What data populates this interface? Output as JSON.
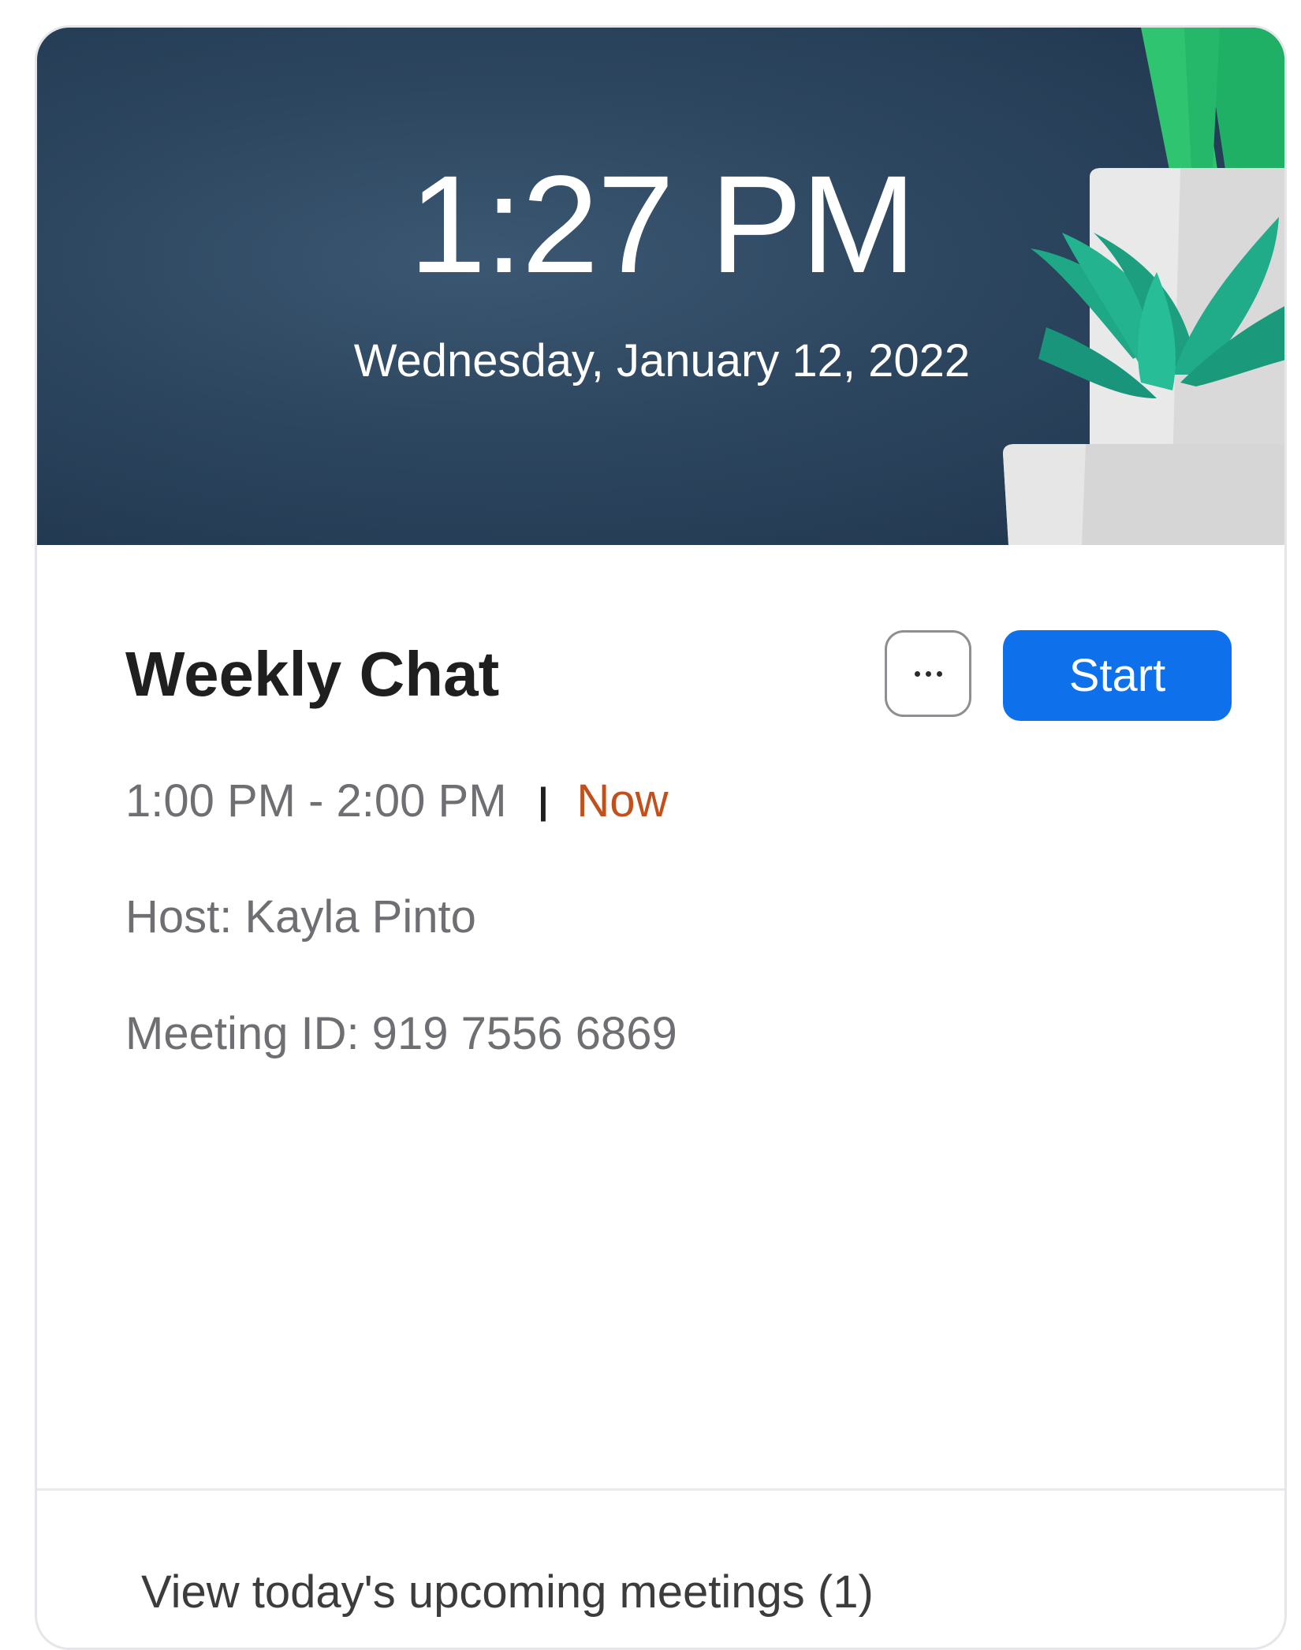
{
  "header": {
    "time": "1:27 PM",
    "date": "Wednesday, January 12, 2022"
  },
  "meeting": {
    "title": "Weekly Chat",
    "time_range": "1:00 PM - 2:00 PM",
    "separator": "|",
    "status": "Now",
    "host": "Host: Kayla Pinto",
    "meeting_id": "Meeting ID: 919 7556 6869"
  },
  "actions": {
    "more_icon": "ellipsis-icon",
    "start_label": "Start"
  },
  "footer": {
    "upcoming_link": "View today's upcoming meetings (1)"
  },
  "colors": {
    "header_bg": "#2d4660",
    "start_button": "#0e71eb",
    "status_now": "#c2501c",
    "plant_green": "#1fa886",
    "plant_light_green": "#2fc46f",
    "pot": "#e0e0e0"
  }
}
